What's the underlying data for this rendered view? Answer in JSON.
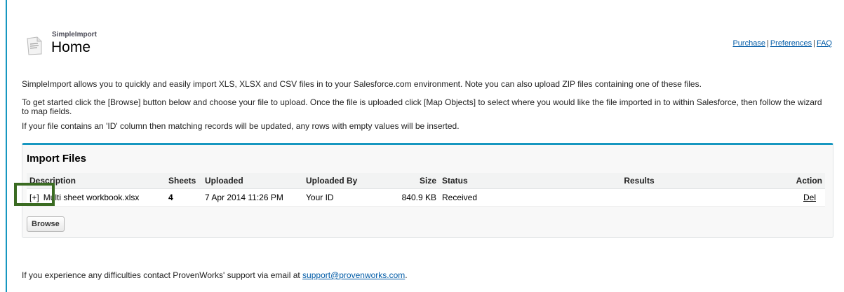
{
  "header": {
    "app_name": "SimpleImport",
    "title": "Home",
    "links": {
      "purchase": "Purchase",
      "preferences": "Preferences",
      "faq": "FAQ",
      "separator": "|"
    },
    "icon": "document-page-icon"
  },
  "intro": {
    "line1": "SimpleImport allows you to quickly and easily import XLS, XLSX and CSV files in to your Salesforce.com environment. Note you can also upload ZIP files containing one of these files.",
    "line2": "To get started click the [Browse] button below and choose your file to upload. Once the file is uploaded click [Map Objects] to select where you would like the file imported in to within Salesforce, then follow the wizard to map fields.",
    "line3": "If your file contains an 'ID' column then matching records will be updated, any rows with empty values will be inserted."
  },
  "import_panel": {
    "title": "Import Files",
    "columns": {
      "description": "Description",
      "sheets": "Sheets",
      "uploaded": "Uploaded",
      "uploaded_by": "Uploaded By",
      "size": "Size",
      "status": "Status",
      "results": "Results",
      "action": "Action"
    },
    "rows": [
      {
        "expand": "[+]",
        "description": "Multi sheet workbook.xlsx",
        "sheets": "4",
        "uploaded": "7 Apr 2014 11:26 PM",
        "uploaded_by": "Your ID",
        "size": "840.9 KB",
        "status": "Received",
        "results": "",
        "action": "Del"
      }
    ],
    "browse_label": "Browse"
  },
  "footer": {
    "text": "If you experience any difficulties contact ProvenWorks' support via email at ",
    "email": "support@provenworks.com",
    "end": "."
  },
  "colors": {
    "accent": "#1797c0",
    "link": "#015ba7",
    "highlight": "#3a6b22"
  }
}
